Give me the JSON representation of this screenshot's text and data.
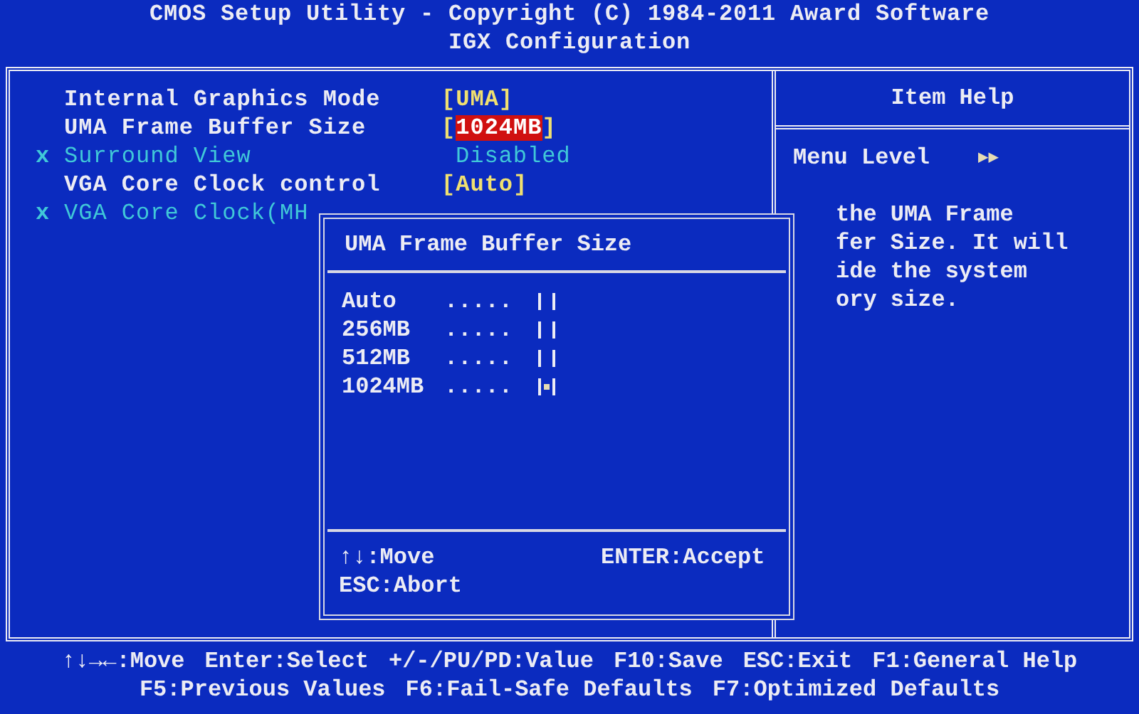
{
  "header": {
    "title": "CMOS Setup Utility - Copyright (C) 1984-2011 Award Software",
    "subtitle": "IGX Configuration"
  },
  "items": [
    {
      "marker": "",
      "label": "Internal Graphics Mode",
      "open": "[",
      "value": "UMA",
      "close": "]",
      "disabled": false,
      "selected": false
    },
    {
      "marker": "",
      "label": "UMA Frame Buffer Size",
      "open": "[",
      "value": "1024MB",
      "close": "]",
      "disabled": false,
      "selected": true
    },
    {
      "marker": "x",
      "label": "Surround View",
      "value": "Disabled",
      "disabled": true,
      "selected": false
    },
    {
      "marker": "",
      "label": "VGA Core Clock control",
      "open": "[",
      "value": "Auto",
      "close": "]",
      "disabled": false,
      "selected": false
    },
    {
      "marker": "x",
      "label": "VGA Core Clock(MH",
      "disabled": true,
      "selected": false
    }
  ],
  "item_help": {
    "title": "Item Help",
    "menu_level_label": "Menu Level",
    "menu_level_glyph": "▶▶",
    "lines": [
      "the UMA Frame",
      "fer Size. It will",
      "ide the system",
      "ory size."
    ]
  },
  "popup": {
    "title": "UMA Frame Buffer Size",
    "options": [
      {
        "label": "Auto",
        "dots": ".....",
        "selected": false
      },
      {
        "label": "256MB",
        "dots": ".....",
        "selected": false
      },
      {
        "label": "512MB",
        "dots": ".....",
        "selected": false
      },
      {
        "label": "1024MB",
        "dots": ".....",
        "selected": true
      }
    ],
    "hints": [
      "↑↓:Move",
      "ENTER:Accept",
      "ESC:Abort"
    ]
  },
  "footer": [
    [
      "↑↓→←:Move",
      "Enter:Select",
      "+/-/PU/PD:Value",
      "F10:Save",
      "ESC:Exit",
      "F1:General Help"
    ],
    [
      "F5:Previous Values",
      "F6:Fail-Safe Defaults",
      "F7:Optimized Defaults"
    ]
  ]
}
